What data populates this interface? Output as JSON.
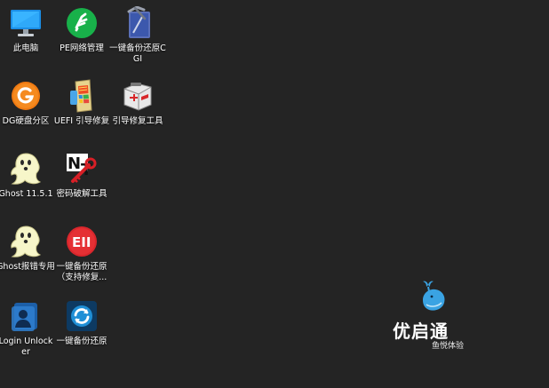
{
  "desktop": {
    "icons": [
      {
        "label": "此电脑",
        "icon": "monitor-icon"
      },
      {
        "label": "PE网络管理",
        "icon": "network-manager-icon"
      },
      {
        "label": "一键备份还原CGI",
        "icon": "cgi-backup-icon"
      },
      {
        "label": "DG硬盘分区",
        "icon": "diskgenius-icon"
      },
      {
        "label": "UEFI 引导修复",
        "icon": "uefi-repair-icon"
      },
      {
        "label": "引导修复工具",
        "icon": "first-aid-kit-icon"
      },
      {
        "label": "Ghost 11.5.1",
        "icon": "ghost-icon"
      },
      {
        "label": "密码破解工具",
        "icon": "nt-password-icon"
      },
      {
        "label": "Ghost报错专用",
        "icon": "ghost-error-icon"
      },
      {
        "label": "一键备份还原（支持修复...",
        "icon": "eii-backup-icon"
      },
      {
        "label": "Login Unlocker",
        "icon": "login-unlocker-icon"
      },
      {
        "label": "一键备份还原",
        "icon": "sync-backup-icon"
      }
    ]
  },
  "brand": {
    "name": "优启通",
    "tagline": "鱼悦体验",
    "accent": "#3aa3e3"
  }
}
